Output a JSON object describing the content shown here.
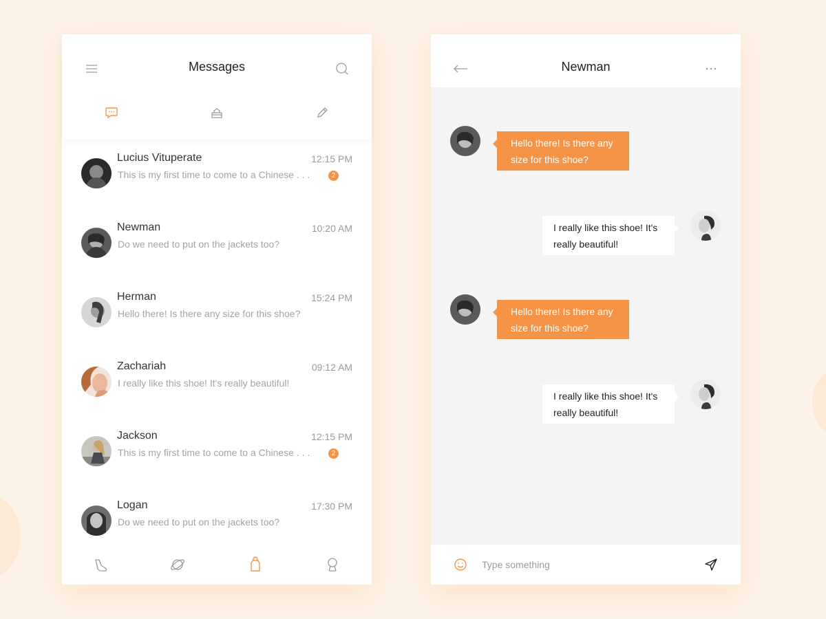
{
  "colors": {
    "accent": "#f59446",
    "background": "#fdf3e8",
    "chat_background": "#f4f4f4"
  },
  "messages_screen": {
    "header": {
      "title": "Messages",
      "menu_icon": "menu-icon",
      "search_icon": "search-icon"
    },
    "tabs": [
      {
        "icon": "chat-bubble-icon",
        "active": true
      },
      {
        "icon": "cake-icon",
        "active": false
      },
      {
        "icon": "pencil-icon",
        "active": false
      }
    ],
    "conversations": [
      {
        "name": "Lucius Vituperate",
        "time": "12:15 PM",
        "preview": "This is my first time to come to a Chinese . . .",
        "unread": "2"
      },
      {
        "name": "Newman",
        "time": "10:20 AM",
        "preview": "Do we need to put on the jackets too?",
        "unread": null
      },
      {
        "name": "Herman",
        "time": "15:24 PM",
        "preview": "Hello there! Is there any size for this shoe?",
        "unread": null
      },
      {
        "name": "Zachariah",
        "time": "09:12 AM",
        "preview": "I really like this shoe! It's really beautiful!",
        "unread": null
      },
      {
        "name": "Jackson",
        "time": "12:15 PM",
        "preview": "This is my first time to come to a Chinese . . .",
        "unread": "2"
      },
      {
        "name": "Logan",
        "time": "17:30 PM",
        "preview": "Do we need to put on the jackets too?",
        "unread": null
      }
    ],
    "bottom_nav": [
      {
        "icon": "shoe-icon",
        "active": false
      },
      {
        "icon": "planet-icon",
        "active": false
      },
      {
        "icon": "bag-icon",
        "active": true
      },
      {
        "icon": "profile-icon",
        "active": false
      }
    ]
  },
  "chat_screen": {
    "header": {
      "title": "Newman",
      "back_icon": "back-arrow-icon",
      "more_icon": "more-icon"
    },
    "messages": [
      {
        "direction": "incoming",
        "text_line1": "Hello there! Is there any",
        "text_line2": "size for this shoe?"
      },
      {
        "direction": "outgoing",
        "text_line1": "I really like this shoe! It's",
        "text_line2": "really beautiful!"
      },
      {
        "direction": "incoming",
        "text_line1": "Hello there! Is there any",
        "text_line2": "size for this shoe?"
      },
      {
        "direction": "outgoing",
        "text_line1": "I really like this shoe! It's",
        "text_line2": "really beautiful!"
      }
    ],
    "composer": {
      "placeholder": "Type something",
      "value": "",
      "emoji_icon": "emoji-icon",
      "send_icon": "send-icon"
    }
  }
}
